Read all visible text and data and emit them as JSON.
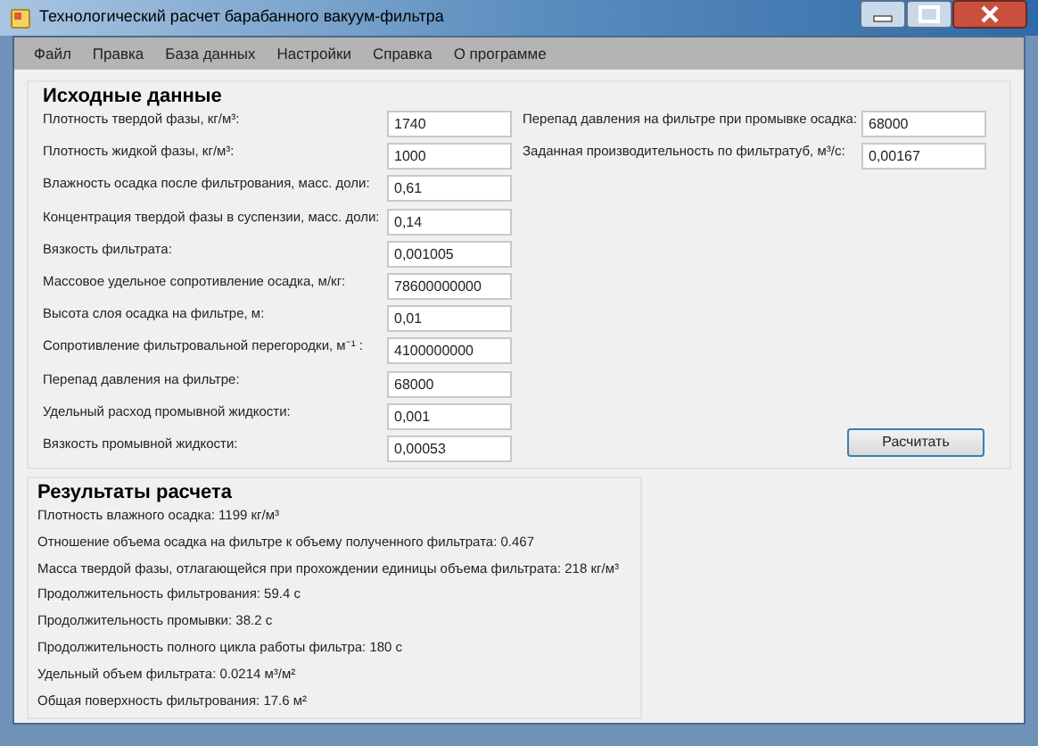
{
  "window": {
    "title": "Технологический расчет барабанного вакуум-фильтра"
  },
  "menu": [
    "Файл",
    "Правка",
    "База данных",
    "Настройки",
    "Справка",
    "О программе"
  ],
  "inputs": {
    "title": "Исходные данные",
    "left_fields": [
      {
        "label": "Плотность твердой фазы, кг/м³:",
        "value": "1740"
      },
      {
        "label": "Плотность жидкой фазы, кг/м³:",
        "value": "1000"
      },
      {
        "label": "Влажность осадка после фильтрования, масс. доли:",
        "value": "0,61"
      },
      {
        "label": "Концентрация твердой фазы в суспензии, масс. доли:",
        "value": "0,14"
      },
      {
        "label": "Вязкость фильтрата:",
        "value": "0,001005"
      },
      {
        "label": "Массовое удельное сопротивление осадка, м/кг:",
        "value": "78600000000"
      },
      {
        "label": "Высота слоя осадка на фильтре, м:",
        "value": "0,01"
      },
      {
        "label": "Сопротивление фильтровальной перегородки, м⁻¹ :",
        "value": "4100000000"
      },
      {
        "label": "Перепад давления на фильтре:",
        "value": "68000"
      },
      {
        "label": "Удельный расход промывной жидкости:",
        "value": "0,001"
      },
      {
        "label": "Вязкость промывной жидкости:",
        "value": "0,00053"
      }
    ],
    "right_fields": [
      {
        "label": "Перепад давления на фильтре при промывке осадка:",
        "value": "68000"
      },
      {
        "label": "Заданная производительность по фильтратуб, м³/с:",
        "value": "0,00167"
      }
    ],
    "button": "Расчитать"
  },
  "results": {
    "title": "Результаты расчета",
    "lines": [
      "Плотность влажного осадка: 1199 кг/м³",
      "Отношение объема осадка на фильтре к объему полученного фильтрата: 0.467",
      "Масса твердой фазы, отлагающейся при прохождении единицы объема фильтрата: 218 кг/м³",
      "Продолжительность фильтрования: 59.4 с",
      "Продолжительность промывки: 38.2 с",
      "Продолжительность полного цикла работы фильтра: 180 с",
      "Удельный объем фильтрата: 0.0214 м³/м²",
      "Общая поверхность фильтрования: 17.6 м²"
    ]
  }
}
